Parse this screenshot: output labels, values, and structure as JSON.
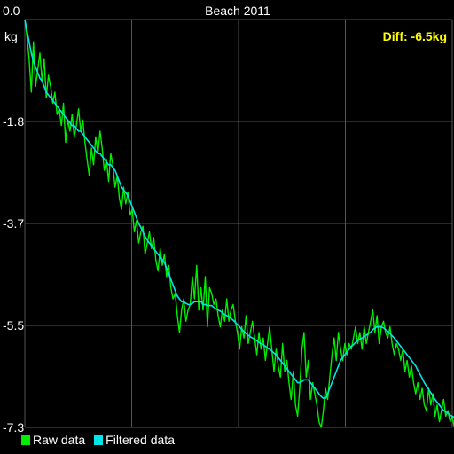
{
  "chart_data": {
    "type": "line",
    "title": "Beach 2011",
    "unit_label": "kg",
    "annotation": "Diff: -6.5kg",
    "y_tick_labels": [
      "0.0",
      "-1.8",
      "-3.7",
      "-5.5",
      "-7.3"
    ],
    "ylim": [
      -7.3,
      0.0
    ],
    "grid": true,
    "x_count": 200,
    "legend_position": "bottom-left",
    "colors": {
      "background": "#000000",
      "grid": "#555555",
      "raw": "#00ee00",
      "filtered": "#00e5e5",
      "annotation": "#ffff00",
      "text": "#ffffff"
    },
    "series": [
      {
        "name": "Raw data",
        "values": [
          0.0,
          -0.3,
          -0.7,
          -1.3,
          -0.4,
          -1.2,
          -0.9,
          -0.6,
          -1.1,
          -0.7,
          -1.4,
          -1.0,
          -1.2,
          -1.5,
          -1.3,
          -1.7,
          -1.6,
          -1.9,
          -1.5,
          -2.2,
          -1.8,
          -2.0,
          -1.7,
          -2.1,
          -1.9,
          -1.6,
          -2.0,
          -1.8,
          -2.2,
          -2.5,
          -2.8,
          -2.3,
          -2.6,
          -2.1,
          -2.4,
          -2.0,
          -2.3,
          -2.7,
          -2.5,
          -2.9,
          -2.4,
          -2.6,
          -3.0,
          -2.8,
          -3.2,
          -3.4,
          -3.0,
          -3.3,
          -3.1,
          -3.5,
          -3.4,
          -3.8,
          -3.6,
          -4.0,
          -3.8,
          -3.7,
          -4.2,
          -4.0,
          -3.8,
          -4.1,
          -3.9,
          -4.3,
          -4.5,
          -4.1,
          -4.4,
          -4.2,
          -4.6,
          -4.4,
          -4.8,
          -5.0,
          -4.9,
          -5.3,
          -5.6,
          -5.2,
          -5.0,
          -5.4,
          -5.2,
          -5.1,
          -4.6,
          -5.0,
          -4.4,
          -5.2,
          -4.8,
          -5.2,
          -4.6,
          -5.5,
          -4.8,
          -4.9,
          -5.1,
          -5.0,
          -5.3,
          -5.5,
          -5.2,
          -5.4,
          -5.0,
          -5.4,
          -5.2,
          -5.1,
          -5.4,
          -5.6,
          -5.9,
          -5.5,
          -5.7,
          -5.3,
          -5.8,
          -5.6,
          -5.4,
          -5.7,
          -6.0,
          -5.6,
          -5.9,
          -5.7,
          -6.1,
          -5.8,
          -5.5,
          -5.9,
          -6.3,
          -5.9,
          -6.2,
          -6.4,
          -5.8,
          -6.3,
          -6.1,
          -6.5,
          -6.8,
          -6.3,
          -6.9,
          -7.1,
          -6.6,
          -5.9,
          -5.6,
          -6.4,
          -6.1,
          -6.8,
          -6.5,
          -6.7,
          -6.9,
          -7.2,
          -7.3,
          -7.0,
          -6.6,
          -6.8,
          -6.4,
          -6.0,
          -5.7,
          -6.1,
          -5.6,
          -5.9,
          -6.1,
          -5.8,
          -6.0,
          -5.8,
          -5.9,
          -5.7,
          -5.5,
          -5.8,
          -5.6,
          -5.9,
          -5.5,
          -5.8,
          -5.6,
          -5.4,
          -5.2,
          -5.6,
          -5.3,
          -5.8,
          -5.5,
          -5.4,
          -5.6,
          -5.7,
          -5.5,
          -5.8,
          -6.0,
          -5.8,
          -5.9,
          -6.1,
          -5.9,
          -6.3,
          -6.1,
          -6.4,
          -6.2,
          -6.5,
          -6.7,
          -6.5,
          -6.8,
          -6.6,
          -6.9,
          -7.0,
          -6.6,
          -6.9,
          -6.7,
          -7.1,
          -6.9,
          -7.2,
          -7.0,
          -6.8,
          -7.1,
          -7.0,
          -7.2,
          -7.1,
          -7.3,
          -7.2
        ],
        "color": "#00ee00"
      },
      {
        "name": "Filtered data",
        "values": [
          0.0,
          -0.2,
          -0.4,
          -0.6,
          -0.75,
          -0.85,
          -0.95,
          -1.05,
          -1.1,
          -1.2,
          -1.3,
          -1.35,
          -1.4,
          -1.45,
          -1.5,
          -1.55,
          -1.6,
          -1.65,
          -1.7,
          -1.75,
          -1.8,
          -1.85,
          -1.9,
          -1.9,
          -1.95,
          -2.0,
          -2.0,
          -2.05,
          -2.1,
          -2.15,
          -2.2,
          -2.25,
          -2.3,
          -2.35,
          -2.4,
          -2.4,
          -2.45,
          -2.5,
          -2.55,
          -2.6,
          -2.6,
          -2.65,
          -2.7,
          -2.8,
          -2.9,
          -3.0,
          -3.05,
          -3.1,
          -3.15,
          -3.25,
          -3.35,
          -3.45,
          -3.55,
          -3.65,
          -3.72,
          -3.8,
          -3.88,
          -3.95,
          -4.0,
          -4.05,
          -4.1,
          -4.15,
          -4.2,
          -4.25,
          -4.3,
          -4.35,
          -4.45,
          -4.55,
          -4.65,
          -4.75,
          -4.85,
          -4.95,
          -5.0,
          -5.05,
          -5.05,
          -5.08,
          -5.1,
          -5.1,
          -5.08,
          -5.05,
          -5.05,
          -5.05,
          -5.05,
          -5.1,
          -5.1,
          -5.12,
          -5.12,
          -5.12,
          -5.15,
          -5.18,
          -5.2,
          -5.22,
          -5.25,
          -5.28,
          -5.3,
          -5.32,
          -5.35,
          -5.38,
          -5.42,
          -5.46,
          -5.5,
          -5.55,
          -5.58,
          -5.62,
          -5.65,
          -5.68,
          -5.7,
          -5.72,
          -5.75,
          -5.78,
          -5.8,
          -5.82,
          -5.85,
          -5.88,
          -5.9,
          -5.93,
          -5.97,
          -6.0,
          -6.05,
          -6.1,
          -6.15,
          -6.2,
          -6.25,
          -6.3,
          -6.35,
          -6.4,
          -6.45,
          -6.5,
          -6.5,
          -6.48,
          -6.45,
          -6.45,
          -6.45,
          -6.5,
          -6.55,
          -6.6,
          -6.65,
          -6.7,
          -6.75,
          -6.78,
          -6.78,
          -6.7,
          -6.6,
          -6.5,
          -6.4,
          -6.3,
          -6.2,
          -6.1,
          -6.05,
          -6.0,
          -5.95,
          -5.9,
          -5.85,
          -5.82,
          -5.78,
          -5.75,
          -5.72,
          -5.7,
          -5.68,
          -5.65,
          -5.62,
          -5.6,
          -5.55,
          -5.52,
          -5.5,
          -5.5,
          -5.5,
          -5.52,
          -5.55,
          -5.58,
          -5.62,
          -5.66,
          -5.7,
          -5.75,
          -5.8,
          -5.85,
          -5.9,
          -5.95,
          -6.0,
          -6.05,
          -6.1,
          -6.15,
          -6.2,
          -6.28,
          -6.35,
          -6.42,
          -6.5,
          -6.56,
          -6.62,
          -6.68,
          -6.74,
          -6.8,
          -6.85,
          -6.9,
          -6.95,
          -7.0,
          -7.02,
          -7.05,
          -7.08,
          -7.1,
          -7.12,
          -7.15,
          -7.18,
          -7.2
        ],
        "color": "#00e5e5"
      }
    ]
  }
}
